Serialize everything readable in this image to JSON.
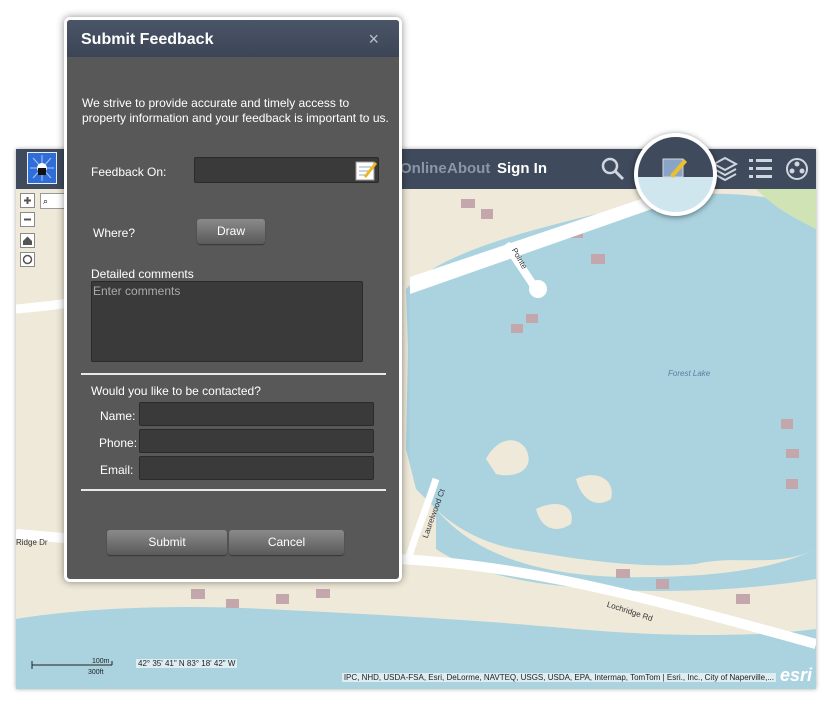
{
  "app": {
    "nav": {
      "online": "Online",
      "about": "About",
      "signin": "Sign In"
    },
    "toolbar_icons": [
      "search-icon",
      "basemap-icon",
      "feedback-icon",
      "layers-icon",
      "legend-icon",
      "film-icon"
    ]
  },
  "map": {
    "scale_m": "100m",
    "scale_ft": "300ft",
    "coordinates": "42° 35' 41\" N 83° 18' 42\" W",
    "attribution": "IPC, NHD, USDA-FSA, Esri, DeLorme, NAVTEQ, USGS, USDA, EPA, Intermap, TomTom | Esri., Inc., City of Naperville,...",
    "esri_logo": "esri",
    "lake_label": "Forest Lake",
    "roads": [
      "Lochridge Rd",
      "Ridge Dr",
      "Laurelwood Ct",
      "Pointe"
    ]
  },
  "dialog": {
    "title": "Submit Feedback",
    "close": "×",
    "intro": "We strive to provide accurate and timely access to property information and your feedback is important to us.",
    "feedback_on_label": "Feedback On:",
    "where_label": "Where?",
    "draw_button": "Draw",
    "comments_label": "Detailed comments",
    "comments_placeholder": "Enter comments",
    "contact_question": "Would you like to be contacted?",
    "name_label": "Name:",
    "phone_label": "Phone:",
    "email_label": "Email:",
    "submit_button": "Submit",
    "cancel_button": "Cancel"
  }
}
